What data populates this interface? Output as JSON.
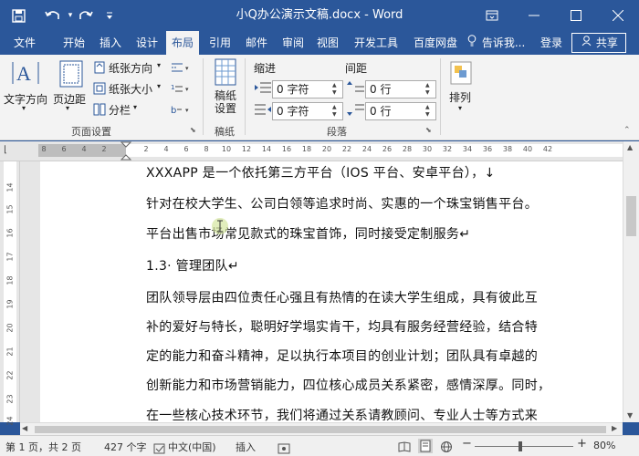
{
  "window": {
    "title": "小Q办公演示文稿.docx - Word",
    "quick_access": {
      "save_icon": "💾",
      "undo_icon": "↶",
      "redo_icon": "↷",
      "customize_icon": "⇟"
    },
    "controls": {
      "ribbon_display": "⧉",
      "minimize": "—",
      "maximize": "☐",
      "close": "✕"
    }
  },
  "tabs": [
    "文件",
    "开始",
    "插入",
    "设计",
    "布局",
    "引用",
    "邮件",
    "审阅",
    "视图",
    "开发工具",
    "百度网盘"
  ],
  "active_tab": "布局",
  "tellme": {
    "icon": "💡",
    "label": "告诉我..."
  },
  "signin": "登录",
  "share": {
    "icon": "👤",
    "label": "共享"
  },
  "ribbon": {
    "page_setup": {
      "group_label": "页面设置",
      "text_direction": "文字方向",
      "margins": "页边距",
      "orientation": "纸张方向",
      "size": "纸张大小",
      "columns": "分栏"
    },
    "draft": {
      "group_label": "稿纸",
      "button": "稿纸\n设置"
    },
    "paragraph": {
      "group_label": "段落",
      "indent_label": "缩进",
      "spacing_label": "间距",
      "indent_left": "0 字符",
      "indent_right": "0 字符",
      "spacing_before": "0 行",
      "spacing_after": "0 行"
    },
    "arrange": {
      "button": "排列"
    }
  },
  "ruler": {
    "marks": [
      "8",
      "6",
      "4",
      "2",
      "",
      "2",
      "4",
      "6",
      "8",
      "10",
      "12",
      "14",
      "16",
      "18",
      "20",
      "22",
      "24",
      "26",
      "28",
      "30",
      "32",
      "34",
      "36",
      "38",
      "40",
      "42"
    ],
    "vertical_marks": [
      "14",
      "15",
      "16",
      "17",
      "18",
      "19",
      "20",
      "21",
      "22",
      "23",
      "24"
    ]
  },
  "document": {
    "lines": [
      "XXXAPP 是一个依托第三方平台（IOS 平台、安卓平台），↓",
      "针对在校大学生、公司白领等追求时尚、实惠的一个珠宝销售平台。",
      "平台出售市场常见款式的珠宝首饰，同时接受定制服务↵",
      "1.3· 管理团队↵",
      "团队领导层由四位责任心强且有热情的在读大学生组成，具有彼此互",
      "补的爱好与特长，聪明好学塌实肯干，均具有服务经营经验，结合特",
      "定的能力和奋斗精神，足以执行本项目的创业计划；团队具有卓越的",
      "创新能力和市场营销能力，四位核心成员关系紧密，感情深厚。同时，",
      "在一些核心技术环节，我们将通过关系请教顾问、专业人士等方式来"
    ]
  },
  "status": {
    "page": "第 1 页，共 2 页",
    "words": "427 个字",
    "language": "中文(中国)",
    "mode": "插入",
    "zoom": "80%"
  }
}
